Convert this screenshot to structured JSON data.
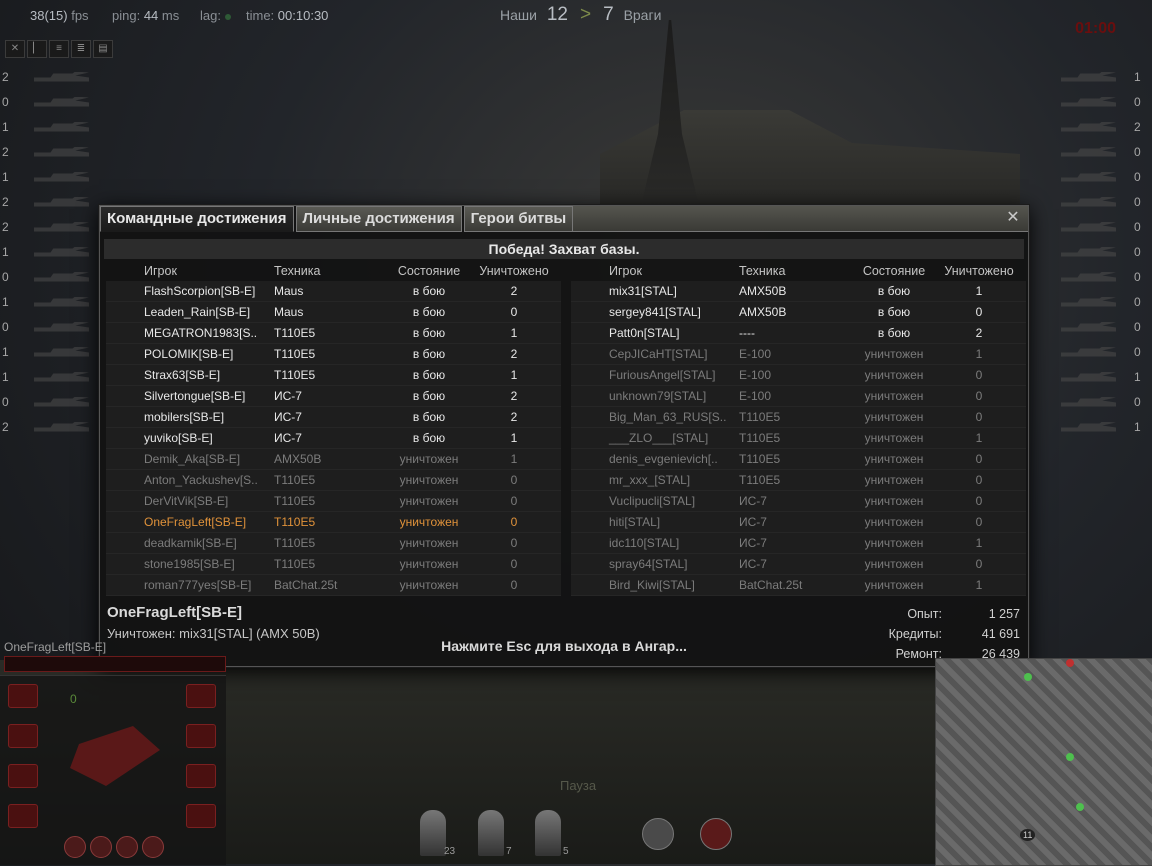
{
  "hud": {
    "fps": "38(15)",
    "fps_unit": "fps",
    "ping_label": "ping:",
    "ping_value": "44",
    "ping_unit": "ms",
    "lag_label": "lag:",
    "time_label": "time:",
    "time_value": "00:10:30",
    "ours_label": "Наши",
    "ours_score": "12",
    "gt": ">",
    "enemy_score": "7",
    "enemy_label": "Враги",
    "timer": "01:00"
  },
  "left_side_counts": [
    "2",
    "0",
    "1",
    "2",
    "1",
    "2",
    "2",
    "1",
    "0",
    "1",
    "0",
    "1",
    "1",
    "0",
    "2"
  ],
  "right_side_counts": [
    "1",
    "0",
    "2",
    "0",
    "0",
    "0",
    "0",
    "0",
    "0",
    "0",
    "0",
    "0",
    "1",
    "0",
    "1"
  ],
  "dialog": {
    "tabs": [
      "Командные достижения",
      "Личные достижения",
      "Герои битвы"
    ],
    "active_tab": 0,
    "close_symbol": "✕",
    "result": "Победа! Захват базы.",
    "headers": {
      "player": "Игрок",
      "tank": "Техника",
      "state": "Состояние",
      "kills": "Уничтожено"
    },
    "allies": [
      {
        "name": "FlashScorpion[SB-E]",
        "tank": "Maus",
        "state": "в бою",
        "kills": "2",
        "status": "alive"
      },
      {
        "name": "Leaden_Rain[SB-E]",
        "tank": "Maus",
        "state": "в бою",
        "kills": "0",
        "status": "alive"
      },
      {
        "name": "MEGATRON1983[S..",
        "tank": "T110E5",
        "state": "в бою",
        "kills": "1",
        "status": "alive"
      },
      {
        "name": "POLOMIK[SB-E]",
        "tank": "T110E5",
        "state": "в бою",
        "kills": "2",
        "status": "alive"
      },
      {
        "name": "Strax63[SB-E]",
        "tank": "T110E5",
        "state": "в бою",
        "kills": "1",
        "status": "alive"
      },
      {
        "name": "Silvertongue[SB-E]",
        "tank": "ИС-7",
        "state": "в бою",
        "kills": "2",
        "status": "alive"
      },
      {
        "name": "mobilers[SB-E]",
        "tank": "ИС-7",
        "state": "в бою",
        "kills": "2",
        "status": "alive"
      },
      {
        "name": "yuviko[SB-E]",
        "tank": "ИС-7",
        "state": "в бою",
        "kills": "1",
        "status": "alive"
      },
      {
        "name": "Demik_Aka[SB-E]",
        "tank": "AMX50B",
        "state": "уничтожен",
        "kills": "1",
        "status": "dead"
      },
      {
        "name": "Anton_Yackushev[S..",
        "tank": "T110E5",
        "state": "уничтожен",
        "kills": "0",
        "status": "dead"
      },
      {
        "name": "DerVitVik[SB-E]",
        "tank": "T110E5",
        "state": "уничтожен",
        "kills": "0",
        "status": "dead"
      },
      {
        "name": "OneFragLeft[SB-E]",
        "tank": "T110E5",
        "state": "уничтожен",
        "kills": "0",
        "status": "self"
      },
      {
        "name": "deadkamik[SB-E]",
        "tank": "T110E5",
        "state": "уничтожен",
        "kills": "0",
        "status": "dead"
      },
      {
        "name": "stone1985[SB-E]",
        "tank": "T110E5",
        "state": "уничтожен",
        "kills": "0",
        "status": "dead"
      },
      {
        "name": "roman777yes[SB-E]",
        "tank": "BatChat.25t",
        "state": "уничтожен",
        "kills": "0",
        "status": "dead"
      }
    ],
    "enemies": [
      {
        "name": "mix31[STAL]",
        "tank": "AMX50B",
        "state": "в бою",
        "kills": "1",
        "status": "alive"
      },
      {
        "name": "sergey841[STAL]",
        "tank": "AMX50B",
        "state": "в бою",
        "kills": "0",
        "status": "alive"
      },
      {
        "name": "Patt0n[STAL]",
        "tank": "----",
        "state": "в бою",
        "kills": "2",
        "status": "alive"
      },
      {
        "name": "CepJICaHT[STAL]",
        "tank": "E-100",
        "state": "уничтожен",
        "kills": "1",
        "status": "dead"
      },
      {
        "name": "FuriousAngel[STAL]",
        "tank": "E-100",
        "state": "уничтожен",
        "kills": "0",
        "status": "dead"
      },
      {
        "name": "unknown79[STAL]",
        "tank": "E-100",
        "state": "уничтожен",
        "kills": "0",
        "status": "dead"
      },
      {
        "name": "Big_Man_63_RUS[S..",
        "tank": "T110E5",
        "state": "уничтожен",
        "kills": "0",
        "status": "dead"
      },
      {
        "name": "___ZLO___[STAL]",
        "tank": "T110E5",
        "state": "уничтожен",
        "kills": "1",
        "status": "dead"
      },
      {
        "name": "denis_evgenievich[..",
        "tank": "T110E5",
        "state": "уничтожен",
        "kills": "0",
        "status": "dead"
      },
      {
        "name": "mr_xxx_[STAL]",
        "tank": "T110E5",
        "state": "уничтожен",
        "kills": "0",
        "status": "dead"
      },
      {
        "name": "Vuclipucli[STAL]",
        "tank": "ИС-7",
        "state": "уничтожен",
        "kills": "0",
        "status": "dead"
      },
      {
        "name": "hiti[STAL]",
        "tank": "ИС-7",
        "state": "уничтожен",
        "kills": "0",
        "status": "dead"
      },
      {
        "name": "idc110[STAL]",
        "tank": "ИС-7",
        "state": "уничтожен",
        "kills": "1",
        "status": "dead"
      },
      {
        "name": "spray64[STAL]",
        "tank": "ИС-7",
        "state": "уничтожен",
        "kills": "0",
        "status": "dead"
      },
      {
        "name": "Bird_Kiwi[STAL]",
        "tank": "BatChat.25t",
        "state": "уничтожен",
        "kills": "1",
        "status": "dead"
      }
    ],
    "footer": {
      "player_name": "OneFragLeft[SB-E]",
      "killed_by": "Уничтожен: mix31[STAL] (AMX 50B)",
      "esc_hint": "Нажмите Esc для выхода в Ангар...",
      "stats": [
        {
          "label": "Опыт:",
          "value": "1 257"
        },
        {
          "label": "Кредиты:",
          "value": "41 691"
        },
        {
          "label": "Ремонт:",
          "value": "26 439"
        }
      ]
    }
  },
  "lower_hud": {
    "player_tag": "OneFragLeft[SB-E]",
    "gun_counter": "0",
    "ammo_counts": [
      "23",
      "7",
      "5"
    ],
    "pause_label": "Пауза",
    "minimap_marker": "11"
  },
  "colors": {
    "self": "#e0923a",
    "alive": "#e8e8e8",
    "dead": "#7c7c7c",
    "timer": "#6a0e0e"
  }
}
